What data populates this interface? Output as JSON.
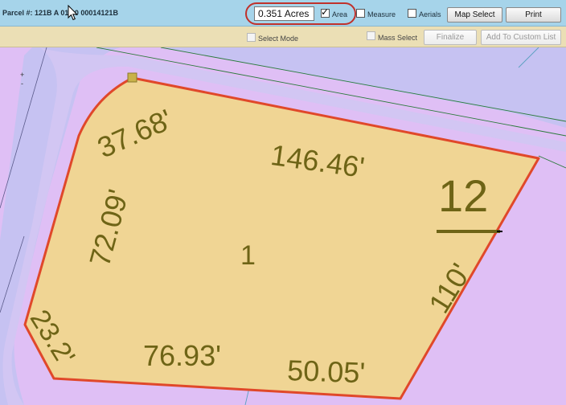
{
  "toolbar": {
    "parcel_label": "Parcel #: 121B A 01   00 00014121B",
    "acres_value": "0.351 Acres",
    "area_label": "Area",
    "area_checked": true,
    "measure_label": "Measure",
    "aerials_label": "Aerials",
    "map_select_label": "Map Select",
    "print_label": "Print"
  },
  "toolbar2": {
    "select_mode_label": "Select Mode",
    "mass_select_label": "Mass Select",
    "finalize_label": "Finalize",
    "add_custom_label": "Add To Custom List"
  },
  "map": {
    "zoom_plus": "+",
    "zoom_minus": "-",
    "parcel_number": "1",
    "block_number": "12",
    "dimensions": {
      "d1": "37.68'",
      "d2": "146.46'",
      "d3": "72.09'",
      "d4": "110'",
      "d5": "23.2'",
      "d6": "76.93'",
      "d7": "50.05'"
    }
  },
  "colors": {
    "toolbar_bg": "#a6d4ea",
    "toolbar2_bg": "#ebdfb5",
    "parcel_fill": "#f0d594",
    "parcel_outline": "#e0482a",
    "map_lavender": "#dfbff5",
    "road_blue": "#c2c0f0",
    "label_olive": "#6e6416"
  }
}
